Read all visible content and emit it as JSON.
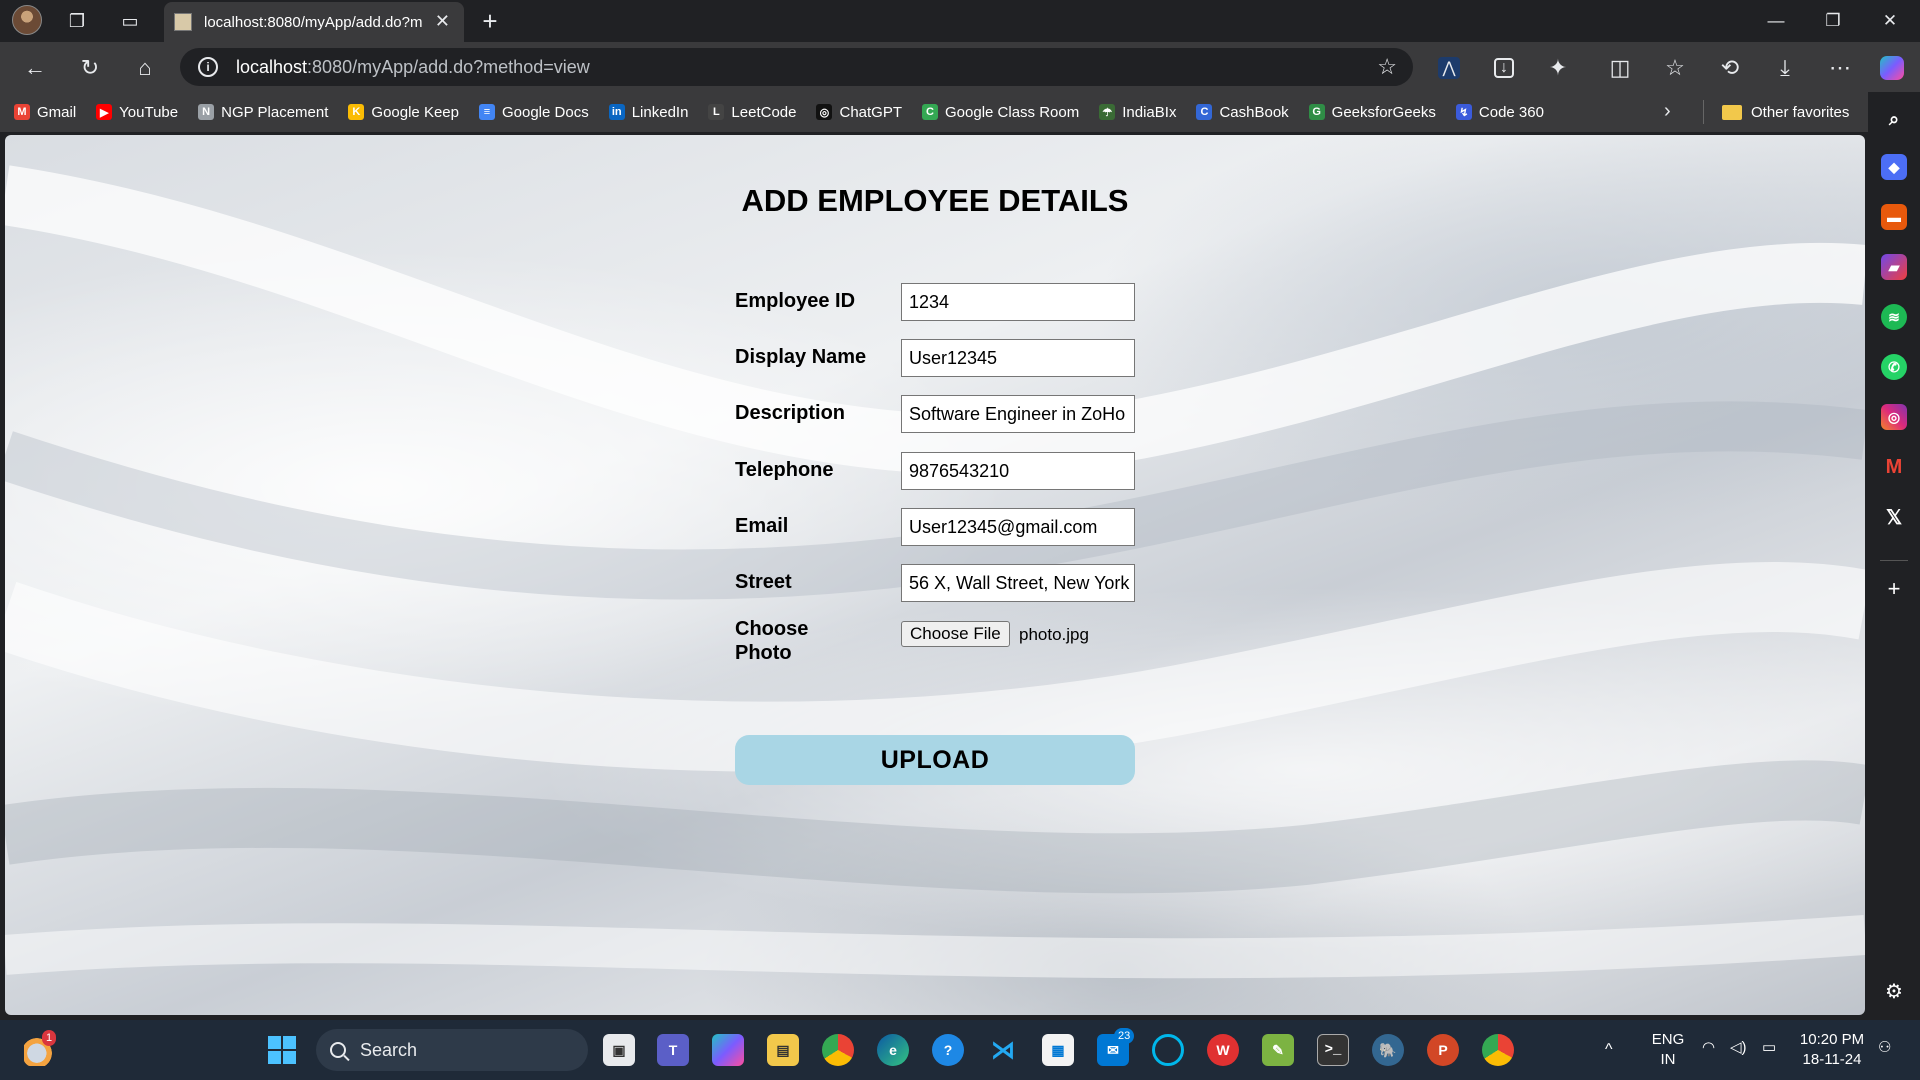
{
  "browser": {
    "tab_title": "localhost:8080/myApp/add.do?m",
    "url_host": "localhost",
    "url_rest": ":8080/myApp/add.do?method=view"
  },
  "bookmarks": [
    {
      "label": "Gmail",
      "color": "#ea4335",
      "glyph": "M"
    },
    {
      "label": "YouTube",
      "color": "#ff0000",
      "glyph": "▶"
    },
    {
      "label": "NGP Placement",
      "color": "#9aa0a6",
      "glyph": "N"
    },
    {
      "label": "Google Keep",
      "color": "#fbbc04",
      "glyph": "K"
    },
    {
      "label": "Google Docs",
      "color": "#4285f4",
      "glyph": "≡"
    },
    {
      "label": "LinkedIn",
      "color": "#0a66c2",
      "glyph": "in"
    },
    {
      "label": "LeetCode",
      "color": "#444444",
      "glyph": "L"
    },
    {
      "label": "ChatGPT",
      "color": "#111111",
      "glyph": "◎"
    },
    {
      "label": "Google Class Room",
      "color": "#34a853",
      "glyph": "C"
    },
    {
      "label": "IndiaBIx",
      "color": "#3a6b35",
      "glyph": "☂"
    },
    {
      "label": "CashBook",
      "color": "#3367d6",
      "glyph": "C"
    },
    {
      "label": "GeeksforGeeks",
      "color": "#2f8d46",
      "glyph": "G"
    },
    {
      "label": "Code 360",
      "color": "#3b5bdb",
      "glyph": "↯"
    }
  ],
  "other_favorites": "Other favorites",
  "form": {
    "title": "ADD EMPLOYEE DETAILS",
    "fields": [
      {
        "label": "Employee ID",
        "value": "1234"
      },
      {
        "label": "Display Name",
        "value": "User12345"
      },
      {
        "label": "Description",
        "value": "Software Engineer in ZoHo"
      },
      {
        "label": "Telephone",
        "value": "9876543210"
      },
      {
        "label": "Email",
        "value": "User12345@gmail.com"
      },
      {
        "label": "Street",
        "value": "56 X, Wall Street, New York"
      }
    ],
    "photo": {
      "label": "Choose Photo",
      "button": "Choose File",
      "filename": "photo.jpg"
    },
    "submit": "UPLOAD",
    "submit_color": "#a9d6e5"
  },
  "taskbar": {
    "search_placeholder": "Search",
    "lang_top": "ENG",
    "lang_bottom": "IN",
    "time": "10:20 PM",
    "date": "18-11-24",
    "weather_badge": "1",
    "mail_badge": "23"
  }
}
